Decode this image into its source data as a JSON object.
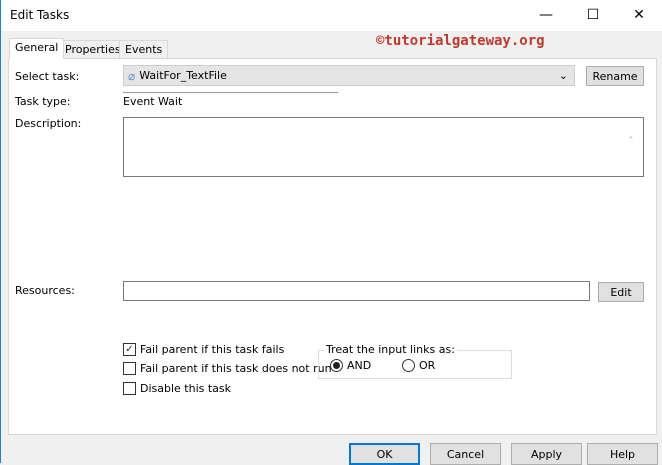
{
  "window": {
    "title": "Edit Tasks",
    "minimize": "—",
    "maximize": "☐",
    "close": "✕"
  },
  "watermark": "©tutorialgateway.org",
  "tabs": [
    {
      "label": "General"
    },
    {
      "label": "Properties"
    },
    {
      "label": "Events"
    }
  ],
  "form": {
    "select_task_label": "Select task:",
    "select_task_value": "WaitFor_TextFile",
    "rename": "Rename",
    "task_type_label": "Task type:",
    "task_type_value": "Event Wait",
    "description_label": "Description:",
    "description_value": "",
    "resources_label": "Resources:",
    "resources_value": "",
    "edit": "Edit"
  },
  "options": {
    "fail_parent_fails": {
      "label": "Fail parent if this task fails",
      "checked": true
    },
    "fail_parent_not_run": {
      "label": "Fail parent if this task does not run",
      "checked": false
    },
    "disable": {
      "label": "Disable this task",
      "checked": false
    }
  },
  "links_group": {
    "title": "Treat the input links as:",
    "and": "AND",
    "or": "OR",
    "selected": "AND"
  },
  "footer": {
    "ok": "OK",
    "cancel": "Cancel",
    "apply": "Apply",
    "help": "Help"
  }
}
